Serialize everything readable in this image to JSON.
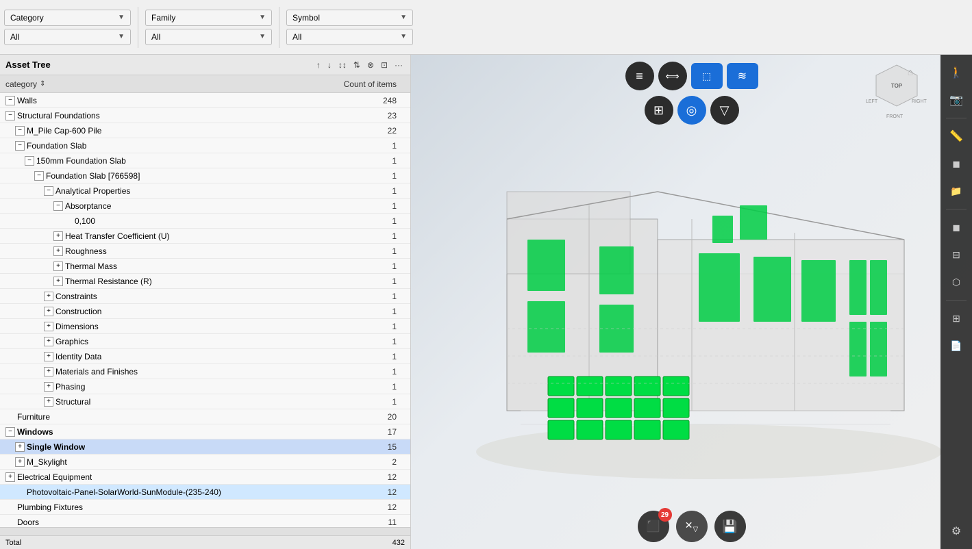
{
  "filters": {
    "category": {
      "label": "Category",
      "value": "All"
    },
    "family": {
      "label": "Family",
      "value": "All"
    },
    "symbol": {
      "label": "Symbol",
      "value": "All"
    }
  },
  "panel": {
    "title": "Asset Tree",
    "columns": {
      "category": "category",
      "count": "Count of items"
    }
  },
  "tree": [
    {
      "id": 1,
      "level": 0,
      "expandable": true,
      "expanded": true,
      "label": "Walls",
      "count": "248",
      "selected": false
    },
    {
      "id": 2,
      "level": 0,
      "expandable": true,
      "expanded": true,
      "label": "Structural Foundations",
      "count": "23",
      "selected": false
    },
    {
      "id": 3,
      "level": 1,
      "expandable": true,
      "expanded": true,
      "label": "M_Pile Cap-600 Pile",
      "count": "22",
      "selected": false
    },
    {
      "id": 4,
      "level": 1,
      "expandable": true,
      "expanded": true,
      "label": "Foundation Slab",
      "count": "1",
      "selected": false
    },
    {
      "id": 5,
      "level": 2,
      "expandable": true,
      "expanded": true,
      "label": "150mm Foundation Slab",
      "count": "1",
      "selected": false
    },
    {
      "id": 6,
      "level": 3,
      "expandable": true,
      "expanded": true,
      "label": "Foundation Slab [766598]",
      "count": "1",
      "selected": false
    },
    {
      "id": 7,
      "level": 4,
      "expandable": true,
      "expanded": true,
      "label": "Analytical Properties",
      "count": "1",
      "selected": false
    },
    {
      "id": 8,
      "level": 5,
      "expandable": true,
      "expanded": true,
      "label": "Absorptance",
      "count": "1",
      "selected": false
    },
    {
      "id": 9,
      "level": 6,
      "expandable": false,
      "expanded": false,
      "label": "0,100",
      "count": "1",
      "selected": false
    },
    {
      "id": 10,
      "level": 5,
      "expandable": true,
      "expanded": false,
      "label": "Heat Transfer Coefficient (U)",
      "count": "1",
      "selected": false
    },
    {
      "id": 11,
      "level": 5,
      "expandable": true,
      "expanded": false,
      "label": "Roughness",
      "count": "1",
      "selected": false
    },
    {
      "id": 12,
      "level": 5,
      "expandable": true,
      "expanded": false,
      "label": "Thermal Mass",
      "count": "1",
      "selected": false
    },
    {
      "id": 13,
      "level": 5,
      "expandable": true,
      "expanded": false,
      "label": "Thermal Resistance (R)",
      "count": "1",
      "selected": false
    },
    {
      "id": 14,
      "level": 4,
      "expandable": true,
      "expanded": false,
      "label": "Constraints",
      "count": "1",
      "selected": false
    },
    {
      "id": 15,
      "level": 4,
      "expandable": true,
      "expanded": false,
      "label": "Construction",
      "count": "1",
      "selected": false
    },
    {
      "id": 16,
      "level": 4,
      "expandable": true,
      "expanded": false,
      "label": "Dimensions",
      "count": "1",
      "selected": false
    },
    {
      "id": 17,
      "level": 4,
      "expandable": true,
      "expanded": false,
      "label": "Graphics",
      "count": "1",
      "selected": false
    },
    {
      "id": 18,
      "level": 4,
      "expandable": true,
      "expanded": false,
      "label": "Identity Data",
      "count": "1",
      "selected": false
    },
    {
      "id": 19,
      "level": 4,
      "expandable": true,
      "expanded": false,
      "label": "Materials and Finishes",
      "count": "1",
      "selected": false
    },
    {
      "id": 20,
      "level": 4,
      "expandable": true,
      "expanded": false,
      "label": "Phasing",
      "count": "1",
      "selected": false
    },
    {
      "id": 21,
      "level": 4,
      "expandable": true,
      "expanded": false,
      "label": "Structural",
      "count": "1",
      "selected": false
    },
    {
      "id": 22,
      "level": 0,
      "expandable": false,
      "expanded": false,
      "label": "Furniture",
      "count": "20",
      "selected": false
    },
    {
      "id": 23,
      "level": 0,
      "expandable": true,
      "expanded": true,
      "label": "Windows",
      "count": "17",
      "selected": false,
      "bold": true
    },
    {
      "id": 24,
      "level": 1,
      "expandable": true,
      "expanded": false,
      "label": "Single Window",
      "count": "15",
      "selected": true,
      "bold": true
    },
    {
      "id": 25,
      "level": 1,
      "expandable": true,
      "expanded": false,
      "label": "M_Skylight",
      "count": "2",
      "selected": false
    },
    {
      "id": 26,
      "level": 0,
      "expandable": true,
      "expanded": false,
      "label": "Electrical Equipment",
      "count": "12",
      "selected": false
    },
    {
      "id": 27,
      "level": 1,
      "expandable": false,
      "expanded": false,
      "label": "Photovoltaic-Panel-SolarWorld-SunModule-(235-240)",
      "count": "12",
      "selected": false,
      "highlighted": true
    },
    {
      "id": 28,
      "level": 0,
      "expandable": false,
      "expanded": false,
      "label": "Plumbing Fixtures",
      "count": "12",
      "selected": false
    },
    {
      "id": 29,
      "level": 0,
      "expandable": false,
      "expanded": false,
      "label": "Doors",
      "count": "11",
      "selected": false
    }
  ],
  "footer": {
    "total_label": "Total",
    "total_count": "432"
  },
  "viewport": {
    "toolbar": {
      "btns": [
        {
          "id": "layers",
          "icon": "☰",
          "active": false
        },
        {
          "id": "arrows",
          "icon": "⟺",
          "active": false
        },
        {
          "id": "select-box",
          "icon": "⬚",
          "active": false
        },
        {
          "id": "filter-lines",
          "icon": "≡",
          "active": false
        }
      ],
      "btns2": [
        {
          "id": "layers2",
          "icon": "⊞",
          "active": false
        },
        {
          "id": "target",
          "icon": "◎",
          "active": true
        },
        {
          "id": "funnel",
          "icon": "▽",
          "active": false
        }
      ]
    },
    "right_toolbar": [
      {
        "id": "person",
        "icon": "🚶"
      },
      {
        "id": "camera",
        "icon": "📷"
      },
      {
        "id": "ruler",
        "icon": "📏"
      },
      {
        "id": "box3d",
        "icon": "📦"
      },
      {
        "id": "folder",
        "icon": "📁"
      },
      {
        "id": "cube",
        "icon": "◼"
      },
      {
        "id": "layers-stack",
        "icon": "⊟"
      },
      {
        "id": "nodes",
        "icon": "⬡"
      },
      {
        "id": "tree-icon",
        "icon": "⊞"
      },
      {
        "id": "document",
        "icon": "📄"
      },
      {
        "id": "gear",
        "icon": "⚙"
      }
    ],
    "bottom_toolbar": [
      {
        "id": "model-btn",
        "icon": "⬛",
        "badge": "29"
      },
      {
        "id": "filter-x",
        "icon": "✕"
      },
      {
        "id": "save",
        "icon": "💾"
      }
    ],
    "cube_labels": {
      "top": "TOP",
      "left": "LEFT",
      "right": "RIGHT",
      "front": "FRONT"
    }
  }
}
